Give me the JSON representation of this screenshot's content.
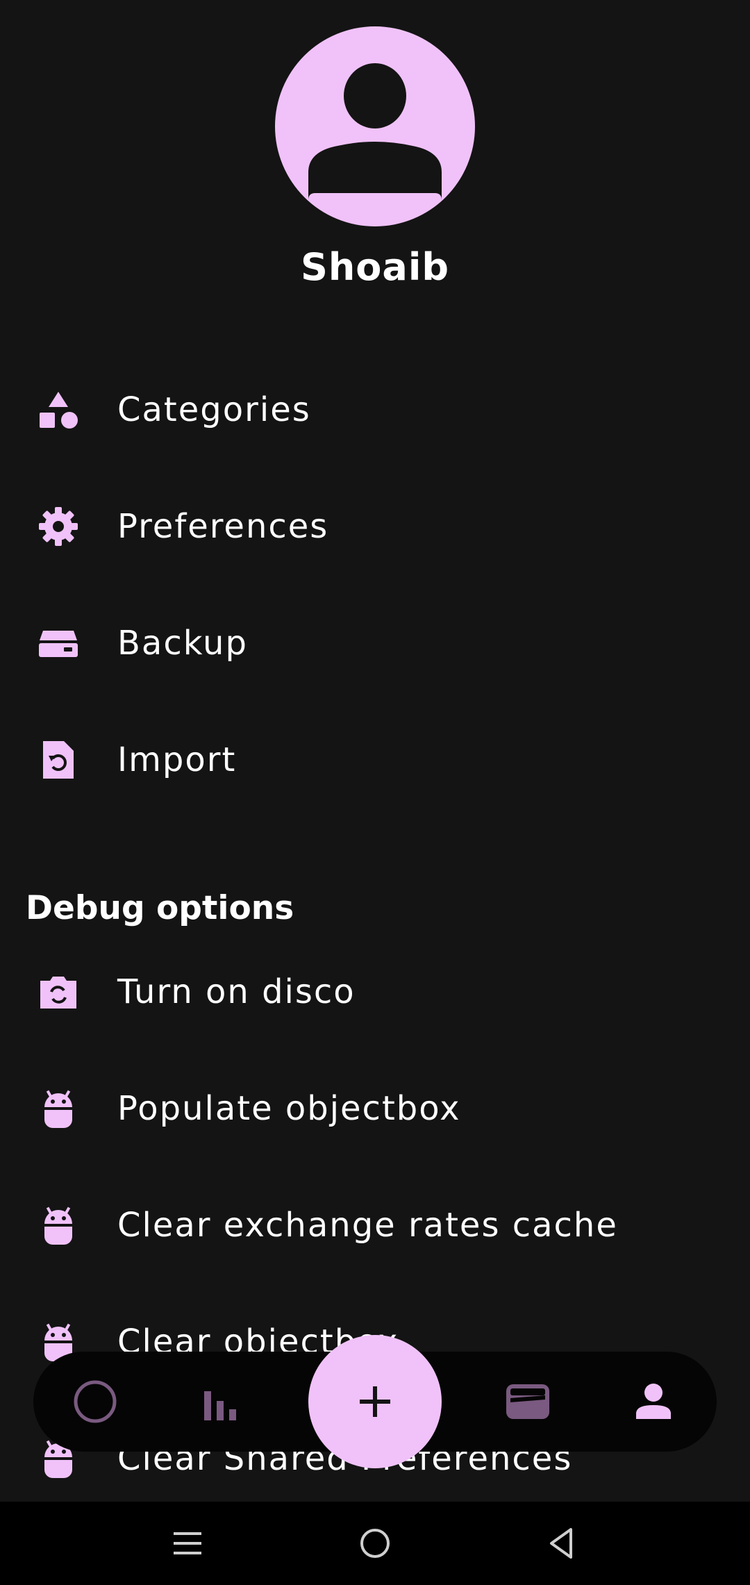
{
  "profile": {
    "name": "Shoaib",
    "avatar_icon": "person-avatar-icon"
  },
  "menu": {
    "items": [
      {
        "label": "Categories",
        "icon": "category-shapes-icon"
      },
      {
        "label": "Preferences",
        "icon": "gear-icon"
      },
      {
        "label": "Backup",
        "icon": "storage-drive-icon"
      },
      {
        "label": "Import",
        "icon": "file-restore-icon"
      }
    ]
  },
  "debug": {
    "title": "Debug options",
    "items": [
      {
        "label": "Turn on disco",
        "icon": "camera-switch-icon"
      },
      {
        "label": "Populate objectbox",
        "icon": "android-icon"
      },
      {
        "label": "Clear exchange rates cache",
        "icon": "android-icon"
      },
      {
        "label": "Clear objectbox",
        "icon": "android-icon"
      },
      {
        "label": "Clear Shared Preferences",
        "icon": "android-icon"
      }
    ]
  },
  "bottom_nav": {
    "items": [
      {
        "name": "home",
        "icon": "circle-icon",
        "active": false
      },
      {
        "name": "stats",
        "icon": "bar-chart-icon",
        "active": false
      },
      {
        "name": "wallet",
        "icon": "wallet-icon",
        "active": false
      },
      {
        "name": "profile",
        "icon": "person-icon",
        "active": true
      }
    ],
    "fab_icon": "plus-icon"
  },
  "system_nav": {
    "items": [
      "menu-icon",
      "home-circle-icon",
      "back-triangle-icon"
    ]
  },
  "colors": {
    "background": "#141414",
    "accent": "#f0c2f9",
    "inactive_icon": "#7a5a80",
    "nav_bar": "#050505",
    "system_bar": "#000000"
  }
}
